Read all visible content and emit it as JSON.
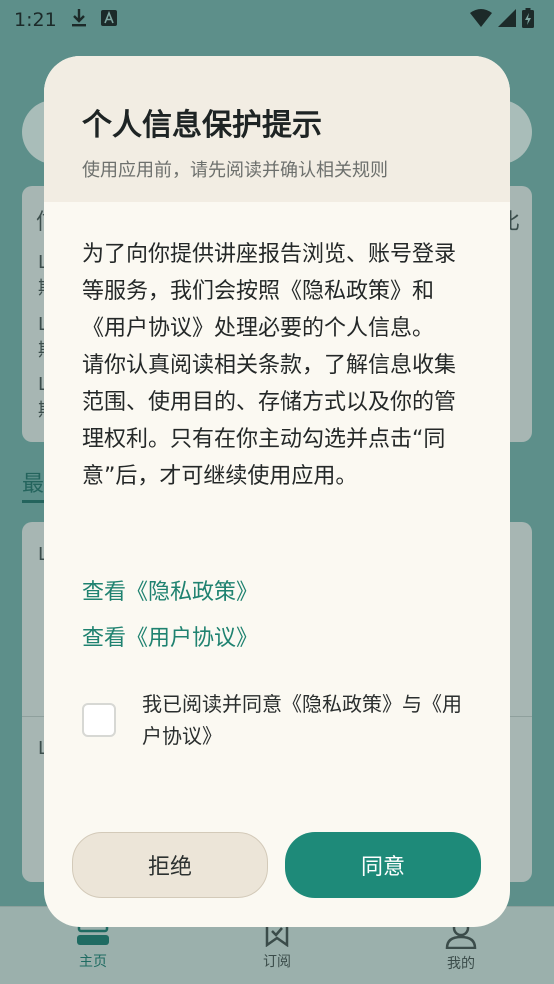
{
  "status_bar": {
    "time": "1:21"
  },
  "background": {
    "card_peek_char": "信",
    "card_peek_char_right": "比",
    "list_peek_char": "L",
    "list_peek_char_2": "期",
    "tab_peek": "最",
    "bottom_nav": [
      {
        "label": "主页",
        "icon": "home-icon",
        "active": true
      },
      {
        "label": "订阅",
        "icon": "bookmark-icon",
        "active": false
      },
      {
        "label": "我的",
        "icon": "user-icon",
        "active": false
      }
    ]
  },
  "dialog": {
    "title": "个人信息保护提示",
    "subtitle": "使用应用前，请先阅读并确认相关规则",
    "body_paragraph_1": "为了向你提供讲座报告浏览、账号登录等服务，我们会按照《隐私政策》和《用户协议》处理必要的个人信息。",
    "body_paragraph_2": "请你认真阅读相关条款，了解信息收集范围、使用目的、存储方式以及你的管理权利。只有在你主动勾选并点击“同意”后，才可继续使用应用。",
    "link_privacy": "查看《隐私政策》",
    "link_agreement": "查看《用户协议》",
    "consent_text": "我已阅读并同意《隐私政策》与《用户协议》",
    "consent_checked": false,
    "reject_label": "拒绝",
    "accept_label": "同意"
  },
  "colors": {
    "accent": "#1e8a79",
    "link": "#1f8270",
    "header_bg": "#f2ede3",
    "dialog_bg": "#fbf9f2"
  }
}
